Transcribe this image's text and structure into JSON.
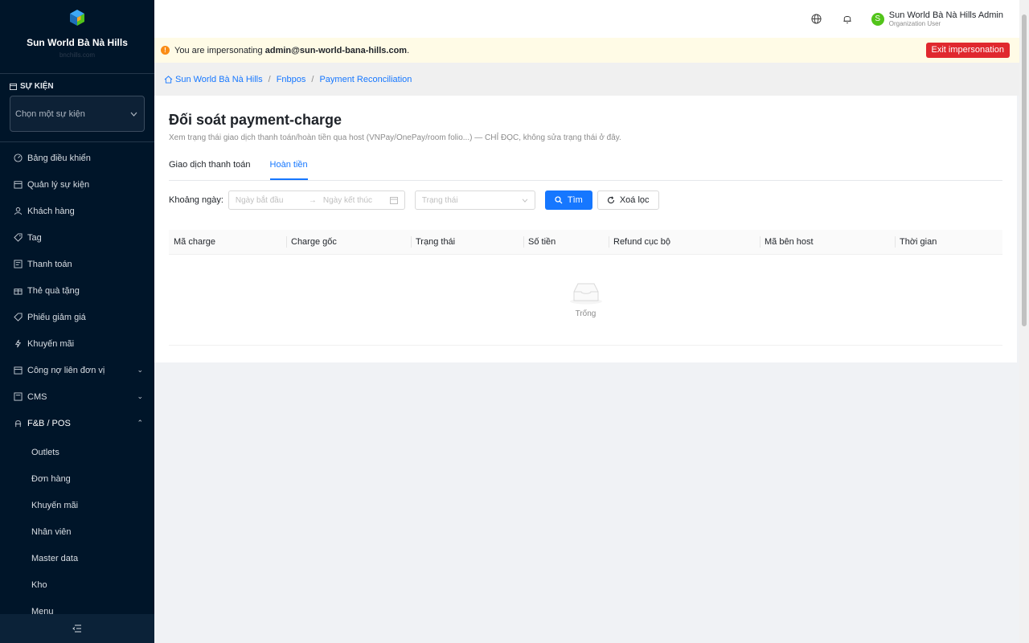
{
  "brand": {
    "name": "Sun World Bà Nà Hills",
    "sub": "bnchills.com"
  },
  "event": {
    "section_title": "SỰ KIỆN",
    "select_placeholder": "Chọn một sự kiện"
  },
  "sidebar": {
    "items": [
      {
        "label": "Bảng điều khiển",
        "icon": "dashboard-icon"
      },
      {
        "label": "Quản lý sự kiện",
        "icon": "calendar-icon"
      },
      {
        "label": "Khách hàng",
        "icon": "user-icon"
      },
      {
        "label": "Tag",
        "icon": "tag-icon"
      },
      {
        "label": "Thanh toán",
        "icon": "payment-icon"
      },
      {
        "label": "Thẻ quà tặng",
        "icon": "gift-icon"
      },
      {
        "label": "Phiếu giảm giá",
        "icon": "coupon-icon"
      },
      {
        "label": "Khuyến mãi",
        "icon": "bolt-icon"
      },
      {
        "label": "Công nợ liên đơn vị",
        "icon": "ledger-icon"
      },
      {
        "label": "CMS",
        "icon": "cms-icon"
      },
      {
        "label": "F&B / POS",
        "icon": "pos-icon"
      }
    ],
    "fnb_subitems": [
      "Outlets",
      "Đơn hàng",
      "Khuyến mãi",
      "Nhân viên",
      "Master data",
      "Kho",
      "Menu"
    ]
  },
  "header": {
    "user_name": "Sun World Bà Nà Hills Admin",
    "user_role": "Organization User",
    "avatar_letter": "S"
  },
  "banner": {
    "prefix": "You are impersonating ",
    "email": "admin@sun-world-bana-hills.com",
    "suffix": ".",
    "exit_label": "Exit impersonation"
  },
  "breadcrumb": [
    "Sun World Bà Nà Hills",
    "Fnbpos",
    "Payment Reconciliation"
  ],
  "page": {
    "title": "Đối soát payment-charge",
    "description": "Xem trạng thái giao dịch thanh toán/hoàn tiền qua host (VNPay/OnePay/room folio...) — CHỈ ĐỌC, không sửa trạng thái ở đây.",
    "tabs": [
      "Giao dịch thanh toán",
      "Hoàn tiền"
    ],
    "active_tab": "Hoàn tiền"
  },
  "filters": {
    "date_label": "Khoảng ngày:",
    "start_placeholder": "Ngày bắt đầu",
    "end_placeholder": "Ngày kết thúc",
    "status_placeholder": "Trạng thái",
    "search_label": "Tìm",
    "clear_label": "Xoá lọc"
  },
  "table": {
    "columns": [
      "Mã charge",
      "Charge gốc",
      "Trạng thái",
      "Số tiền",
      "Refund cục bộ",
      "Mã bên host",
      "Thời gian"
    ],
    "empty_text": "Trống"
  },
  "colors": {
    "sidebar_bg": "#001529",
    "primary": "#1677ff",
    "danger": "#e0282e",
    "banner_bg": "#fffbe6"
  }
}
